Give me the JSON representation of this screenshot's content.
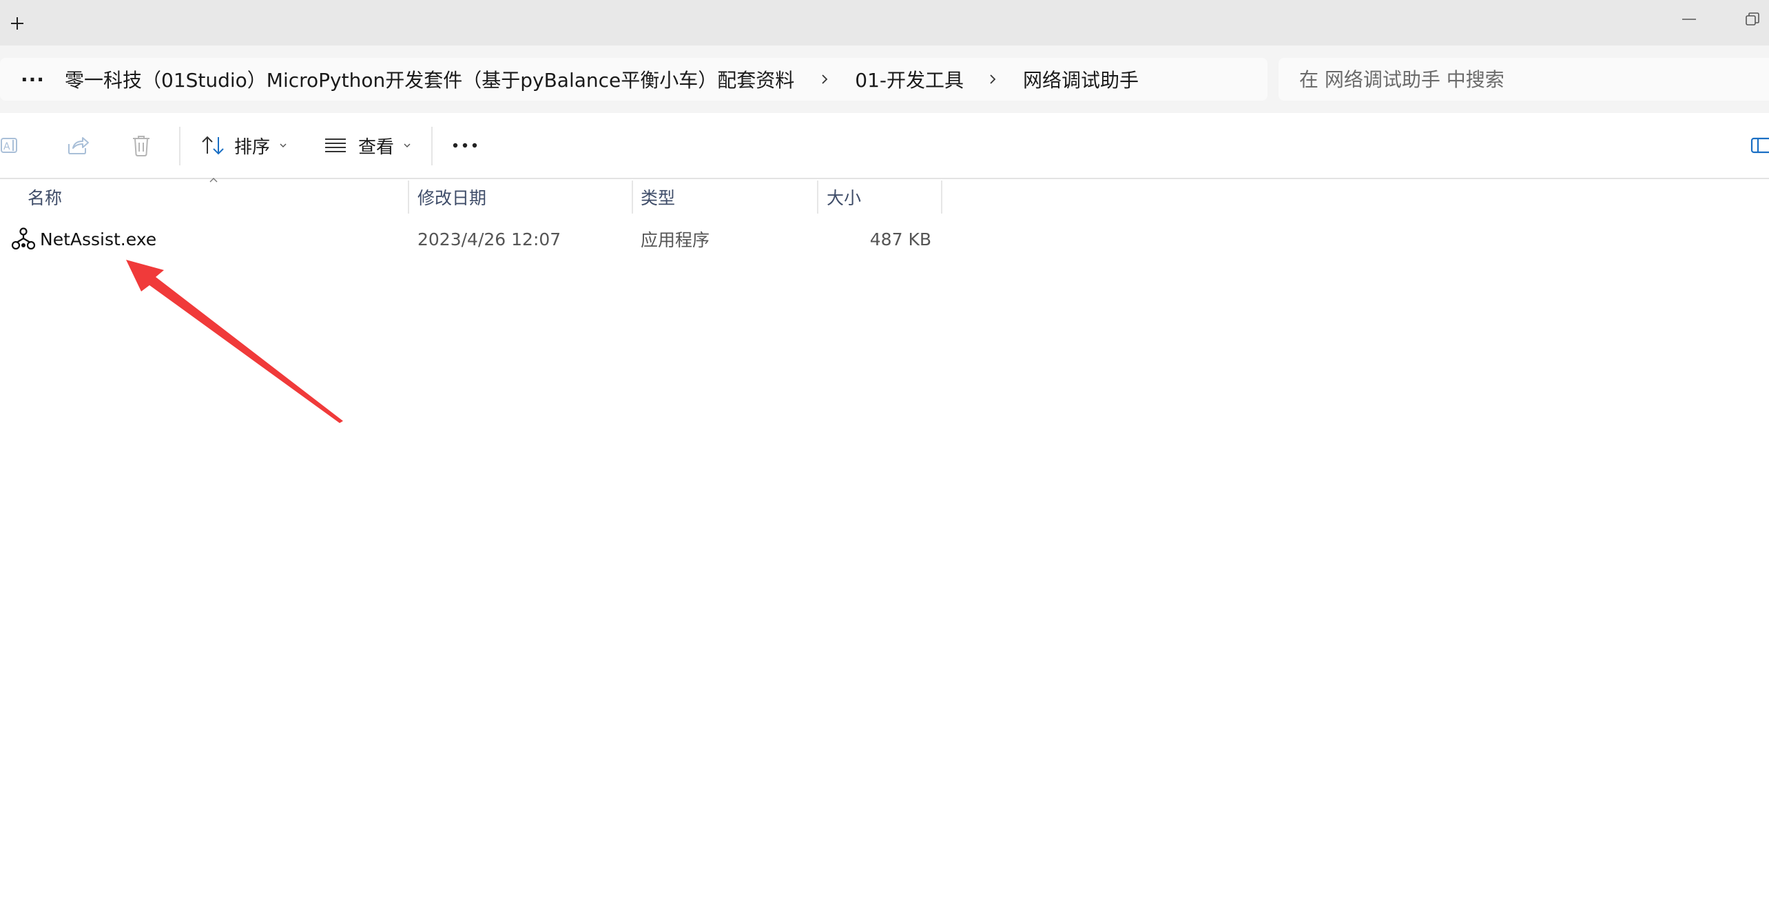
{
  "window": {
    "new_tab_symbol": "+"
  },
  "address": {
    "more_label": "···",
    "crumbs": [
      "零一科技（01Studio）MicroPython开发套件（基于pyBalance平衡小车）配套资料",
      "01-开发工具",
      "网络调试助手"
    ]
  },
  "search": {
    "placeholder": "在 网络调试助手 中搜索"
  },
  "toolbar": {
    "sort_label": "排序",
    "view_label": "查看",
    "more_label": "···"
  },
  "columns": {
    "name": "名称",
    "modified": "修改日期",
    "type": "类型",
    "size": "大小"
  },
  "files": [
    {
      "name": "NetAssist.exe",
      "modified": "2023/4/26 12:07",
      "type": "应用程序",
      "size": "487 KB",
      "icon": "netassist-app-icon"
    }
  ],
  "colors": {
    "annotation_arrow": "#f03a3a",
    "column_header_text": "#3f4d69",
    "titlebar_bg": "#e8e8e8"
  }
}
